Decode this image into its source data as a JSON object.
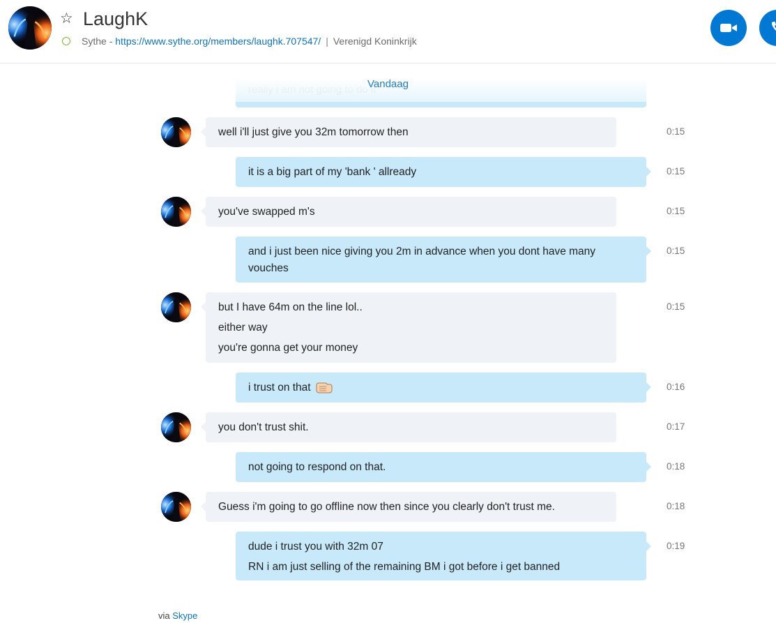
{
  "contact": {
    "name": "LaughK",
    "source": "Sythe",
    "source_sep": " - ",
    "profile_url": "https://www.sythe.org/members/laughk.707547/",
    "divider": "|",
    "location": "Verenigd Koninkrijk",
    "status_color": "#7cb82f"
  },
  "actions": {
    "video_icon": "video-camera-icon",
    "call_icon": "phone-icon",
    "accent": "#0078d4"
  },
  "conversation": {
    "date_label": "Vandaag",
    "faded_text": "really i am not going to do it",
    "messages": [
      {
        "dir": "in",
        "lines": [
          "well i'll just give you 32m tomorrow then"
        ],
        "time": "0:15"
      },
      {
        "dir": "out",
        "lines": [
          "it is a big part of my 'bank ' allready"
        ],
        "time": "0:15"
      },
      {
        "dir": "in",
        "lines": [
          "you've swapped m's"
        ],
        "time": "0:15"
      },
      {
        "dir": "out",
        "lines": [
          "and i just been nice giving you 2m in advance when you dont have many vouches"
        ],
        "time": "0:15"
      },
      {
        "dir": "in",
        "lines": [
          "but I have 64m on the line lol..",
          "either way",
          "you're gonna get your money"
        ],
        "time": "0:15"
      },
      {
        "dir": "out",
        "lines": [
          "i trust on that"
        ],
        "emoji": "fist-bump-emoji",
        "time": "0:16"
      },
      {
        "dir": "in",
        "lines": [
          "you don't trust shit."
        ],
        "time": "0:17"
      },
      {
        "dir": "out",
        "lines": [
          "not going to respond on that."
        ],
        "time": "0:18"
      },
      {
        "dir": "in",
        "lines": [
          "Guess i'm going to go offline now then since you clearly don't trust me."
        ],
        "time": "0:18"
      },
      {
        "dir": "out",
        "lines": [
          "dude i trust you with 32m 07",
          "RN i am just selling of the remaining BM i got before i get banned"
        ],
        "time": "0:19"
      }
    ]
  },
  "footer": {
    "via_text": "via",
    "via_link": "Skype"
  }
}
